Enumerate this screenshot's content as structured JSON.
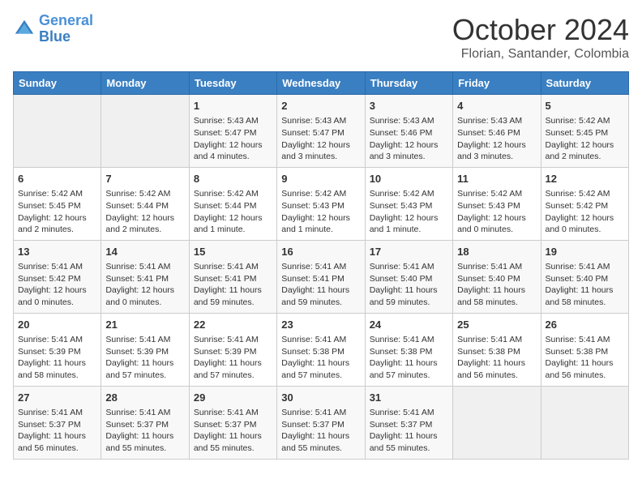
{
  "header": {
    "logo_line1": "General",
    "logo_line2": "Blue",
    "month": "October 2024",
    "location": "Florian, Santander, Colombia"
  },
  "days_of_week": [
    "Sunday",
    "Monday",
    "Tuesday",
    "Wednesday",
    "Thursday",
    "Friday",
    "Saturday"
  ],
  "weeks": [
    [
      {
        "day": "",
        "empty": true
      },
      {
        "day": "",
        "empty": true
      },
      {
        "day": "1",
        "sunrise": "5:43 AM",
        "sunset": "5:47 PM",
        "daylight": "12 hours and 4 minutes."
      },
      {
        "day": "2",
        "sunrise": "5:43 AM",
        "sunset": "5:47 PM",
        "daylight": "12 hours and 3 minutes."
      },
      {
        "day": "3",
        "sunrise": "5:43 AM",
        "sunset": "5:46 PM",
        "daylight": "12 hours and 3 minutes."
      },
      {
        "day": "4",
        "sunrise": "5:43 AM",
        "sunset": "5:46 PM",
        "daylight": "12 hours and 3 minutes."
      },
      {
        "day": "5",
        "sunrise": "5:42 AM",
        "sunset": "5:45 PM",
        "daylight": "12 hours and 2 minutes."
      }
    ],
    [
      {
        "day": "6",
        "sunrise": "5:42 AM",
        "sunset": "5:45 PM",
        "daylight": "12 hours and 2 minutes."
      },
      {
        "day": "7",
        "sunrise": "5:42 AM",
        "sunset": "5:44 PM",
        "daylight": "12 hours and 2 minutes."
      },
      {
        "day": "8",
        "sunrise": "5:42 AM",
        "sunset": "5:44 PM",
        "daylight": "12 hours and 1 minute."
      },
      {
        "day": "9",
        "sunrise": "5:42 AM",
        "sunset": "5:43 PM",
        "daylight": "12 hours and 1 minute."
      },
      {
        "day": "10",
        "sunrise": "5:42 AM",
        "sunset": "5:43 PM",
        "daylight": "12 hours and 1 minute."
      },
      {
        "day": "11",
        "sunrise": "5:42 AM",
        "sunset": "5:43 PM",
        "daylight": "12 hours and 0 minutes."
      },
      {
        "day": "12",
        "sunrise": "5:42 AM",
        "sunset": "5:42 PM",
        "daylight": "12 hours and 0 minutes."
      }
    ],
    [
      {
        "day": "13",
        "sunrise": "5:41 AM",
        "sunset": "5:42 PM",
        "daylight": "12 hours and 0 minutes."
      },
      {
        "day": "14",
        "sunrise": "5:41 AM",
        "sunset": "5:41 PM",
        "daylight": "12 hours and 0 minutes."
      },
      {
        "day": "15",
        "sunrise": "5:41 AM",
        "sunset": "5:41 PM",
        "daylight": "11 hours and 59 minutes."
      },
      {
        "day": "16",
        "sunrise": "5:41 AM",
        "sunset": "5:41 PM",
        "daylight": "11 hours and 59 minutes."
      },
      {
        "day": "17",
        "sunrise": "5:41 AM",
        "sunset": "5:40 PM",
        "daylight": "11 hours and 59 minutes."
      },
      {
        "day": "18",
        "sunrise": "5:41 AM",
        "sunset": "5:40 PM",
        "daylight": "11 hours and 58 minutes."
      },
      {
        "day": "19",
        "sunrise": "5:41 AM",
        "sunset": "5:40 PM",
        "daylight": "11 hours and 58 minutes."
      }
    ],
    [
      {
        "day": "20",
        "sunrise": "5:41 AM",
        "sunset": "5:39 PM",
        "daylight": "11 hours and 58 minutes."
      },
      {
        "day": "21",
        "sunrise": "5:41 AM",
        "sunset": "5:39 PM",
        "daylight": "11 hours and 57 minutes."
      },
      {
        "day": "22",
        "sunrise": "5:41 AM",
        "sunset": "5:39 PM",
        "daylight": "11 hours and 57 minutes."
      },
      {
        "day": "23",
        "sunrise": "5:41 AM",
        "sunset": "5:38 PM",
        "daylight": "11 hours and 57 minutes."
      },
      {
        "day": "24",
        "sunrise": "5:41 AM",
        "sunset": "5:38 PM",
        "daylight": "11 hours and 57 minutes."
      },
      {
        "day": "25",
        "sunrise": "5:41 AM",
        "sunset": "5:38 PM",
        "daylight": "11 hours and 56 minutes."
      },
      {
        "day": "26",
        "sunrise": "5:41 AM",
        "sunset": "5:38 PM",
        "daylight": "11 hours and 56 minutes."
      }
    ],
    [
      {
        "day": "27",
        "sunrise": "5:41 AM",
        "sunset": "5:37 PM",
        "daylight": "11 hours and 56 minutes."
      },
      {
        "day": "28",
        "sunrise": "5:41 AM",
        "sunset": "5:37 PM",
        "daylight": "11 hours and 55 minutes."
      },
      {
        "day": "29",
        "sunrise": "5:41 AM",
        "sunset": "5:37 PM",
        "daylight": "11 hours and 55 minutes."
      },
      {
        "day": "30",
        "sunrise": "5:41 AM",
        "sunset": "5:37 PM",
        "daylight": "11 hours and 55 minutes."
      },
      {
        "day": "31",
        "sunrise": "5:41 AM",
        "sunset": "5:37 PM",
        "daylight": "11 hours and 55 minutes."
      },
      {
        "day": "",
        "empty": true
      },
      {
        "day": "",
        "empty": true
      }
    ]
  ]
}
